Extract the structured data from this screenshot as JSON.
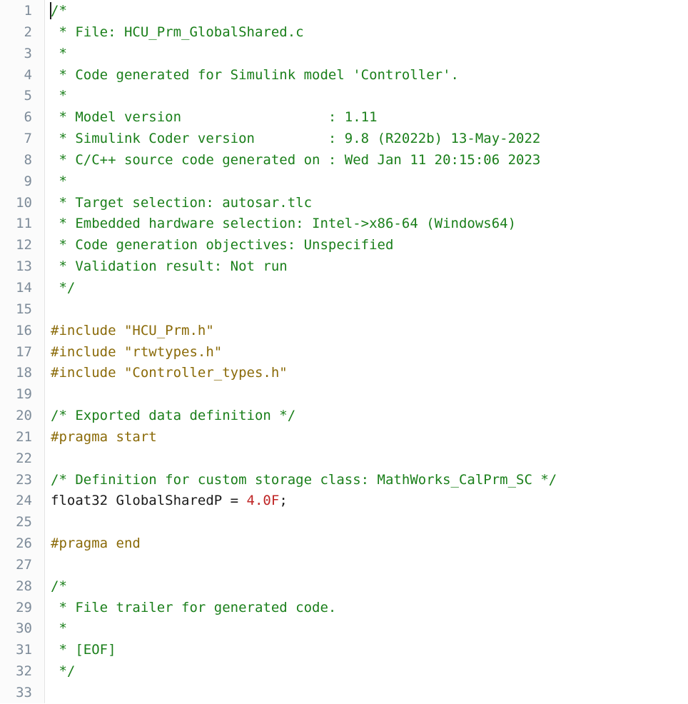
{
  "editor": {
    "name": "code-editor",
    "language": "C",
    "font_size_px": 19,
    "line_height_px": 29.85,
    "background": "#ffffff",
    "gutter_background": "#fbfbfb",
    "gutter_border_color": "#e4e4e4",
    "line_number_color": "#7d8b99",
    "caret": {
      "line": 1,
      "column": 1,
      "visible": true
    },
    "colors": {
      "comment": "#1a7f1a",
      "preprocessor": "#8a6a08",
      "string": "#8a6a08",
      "plain": "#1a1a1a",
      "number": "#bf2626"
    },
    "total_lines": 33,
    "first_visible_line": 1,
    "last_visible_line": 33
  },
  "line_numbers": [
    "1",
    "2",
    "3",
    "4",
    "5",
    "6",
    "7",
    "8",
    "9",
    "10",
    "11",
    "12",
    "13",
    "14",
    "15",
    "16",
    "17",
    "18",
    "19",
    "20",
    "21",
    "22",
    "23",
    "24",
    "25",
    "26",
    "27",
    "28",
    "29",
    "30",
    "31",
    "32",
    "33"
  ],
  "lines": [
    {
      "n": 1,
      "tokens": [
        {
          "t": "comment",
          "s": "/*"
        }
      ]
    },
    {
      "n": 2,
      "tokens": [
        {
          "t": "comment",
          "s": " * File: HCU_Prm_GlobalShared.c"
        }
      ]
    },
    {
      "n": 3,
      "tokens": [
        {
          "t": "comment",
          "s": " *"
        }
      ]
    },
    {
      "n": 4,
      "tokens": [
        {
          "t": "comment",
          "s": " * Code generated for Simulink model 'Controller'."
        }
      ]
    },
    {
      "n": 5,
      "tokens": [
        {
          "t": "comment",
          "s": " *"
        }
      ]
    },
    {
      "n": 6,
      "tokens": [
        {
          "t": "comment",
          "s": " * Model version                  : 1.11"
        }
      ]
    },
    {
      "n": 7,
      "tokens": [
        {
          "t": "comment",
          "s": " * Simulink Coder version         : 9.8 (R2022b) 13-May-2022"
        }
      ]
    },
    {
      "n": 8,
      "tokens": [
        {
          "t": "comment",
          "s": " * C/C++ source code generated on : Wed Jan 11 20:15:06 2023"
        }
      ]
    },
    {
      "n": 9,
      "tokens": [
        {
          "t": "comment",
          "s": " *"
        }
      ]
    },
    {
      "n": 10,
      "tokens": [
        {
          "t": "comment",
          "s": " * Target selection: autosar.tlc"
        }
      ]
    },
    {
      "n": 11,
      "tokens": [
        {
          "t": "comment",
          "s": " * Embedded hardware selection: Intel->x86-64 (Windows64)"
        }
      ]
    },
    {
      "n": 12,
      "tokens": [
        {
          "t": "comment",
          "s": " * Code generation objectives: Unspecified"
        }
      ]
    },
    {
      "n": 13,
      "tokens": [
        {
          "t": "comment",
          "s": " * Validation result: Not run"
        }
      ]
    },
    {
      "n": 14,
      "tokens": [
        {
          "t": "comment",
          "s": " */"
        }
      ]
    },
    {
      "n": 15,
      "tokens": []
    },
    {
      "n": 16,
      "tokens": [
        {
          "t": "pre",
          "s": "#include "
        },
        {
          "t": "str",
          "s": "\"HCU_Prm.h\""
        }
      ]
    },
    {
      "n": 17,
      "tokens": [
        {
          "t": "pre",
          "s": "#include "
        },
        {
          "t": "str",
          "s": "\"rtwtypes.h\""
        }
      ]
    },
    {
      "n": 18,
      "tokens": [
        {
          "t": "pre",
          "s": "#include "
        },
        {
          "t": "str",
          "s": "\"Controller_types.h\""
        }
      ]
    },
    {
      "n": 19,
      "tokens": []
    },
    {
      "n": 20,
      "tokens": [
        {
          "t": "comment",
          "s": "/* Exported data definition */"
        }
      ]
    },
    {
      "n": 21,
      "tokens": [
        {
          "t": "pre",
          "s": "#pragma start"
        }
      ]
    },
    {
      "n": 22,
      "tokens": []
    },
    {
      "n": 23,
      "tokens": [
        {
          "t": "comment",
          "s": "/* Definition for custom storage class: MathWorks_CalPrm_SC */"
        }
      ]
    },
    {
      "n": 24,
      "tokens": [
        {
          "t": "plain",
          "s": "float32 GlobalSharedP = "
        },
        {
          "t": "num",
          "s": "4.0F"
        },
        {
          "t": "plain",
          "s": ";"
        }
      ]
    },
    {
      "n": 25,
      "tokens": []
    },
    {
      "n": 26,
      "tokens": [
        {
          "t": "pre",
          "s": "#pragma end"
        }
      ]
    },
    {
      "n": 27,
      "tokens": []
    },
    {
      "n": 28,
      "tokens": [
        {
          "t": "comment",
          "s": "/*"
        }
      ]
    },
    {
      "n": 29,
      "tokens": [
        {
          "t": "comment",
          "s": " * File trailer for generated code."
        }
      ]
    },
    {
      "n": 30,
      "tokens": [
        {
          "t": "comment",
          "s": " *"
        }
      ]
    },
    {
      "n": 31,
      "tokens": [
        {
          "t": "comment",
          "s": " * [EOF]"
        }
      ]
    },
    {
      "n": 32,
      "tokens": [
        {
          "t": "comment",
          "s": " */"
        }
      ]
    },
    {
      "n": 33,
      "tokens": []
    }
  ]
}
